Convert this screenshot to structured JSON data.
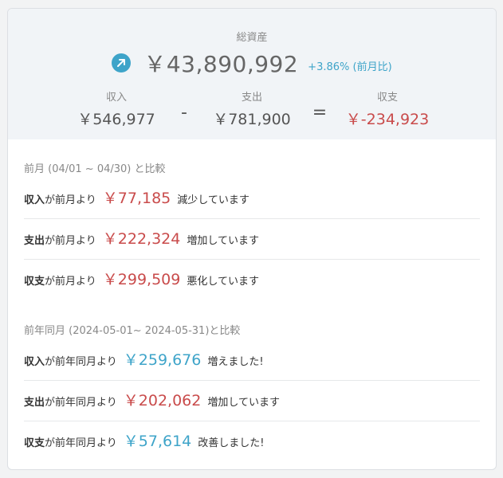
{
  "summary": {
    "total_label": "総資産",
    "total_value": "￥43,890,992",
    "total_change": "+3.86% (前月比)",
    "trend_icon": "arrow-up-right-icon",
    "income_label": "収入",
    "income_value": "￥546,977",
    "minus_op": "-",
    "expense_label": "支出",
    "expense_value": "￥781,900",
    "equals_op": "=",
    "balance_label": "収支",
    "balance_value": "￥-234,923"
  },
  "prev_month": {
    "heading": "前月 (04/01 ~ 04/30) と比較",
    "rows": [
      {
        "lead": "収入",
        "mid": "が前月より",
        "amount": "￥77,185",
        "tail": "減少しています",
        "color": "#c94b4b"
      },
      {
        "lead": "支出",
        "mid": "が前月より",
        "amount": "￥222,324",
        "tail": "増加しています",
        "color": "#c94b4b"
      },
      {
        "lead": "収支",
        "mid": "が前月より",
        "amount": "￥299,509",
        "tail": "悪化しています",
        "color": "#c94b4b"
      }
    ]
  },
  "prev_year": {
    "heading": "前年同月 (2024-05-01~ 2024-05-31)と比較",
    "rows": [
      {
        "lead": "収入",
        "mid": "が前年同月より",
        "amount": "￥259,676",
        "tail": "増えました!",
        "color": "#3ea4c9"
      },
      {
        "lead": "支出",
        "mid": "が前年同月より",
        "amount": "￥202,062",
        "tail": "増加しています",
        "color": "#c94b4b"
      },
      {
        "lead": "収支",
        "mid": "が前年同月より",
        "amount": "￥57,614",
        "tail": "改善しました!",
        "color": "#3ea4c9"
      }
    ]
  },
  "colors": {
    "accent": "#3ea4c9",
    "negative": "#c94b4b"
  }
}
